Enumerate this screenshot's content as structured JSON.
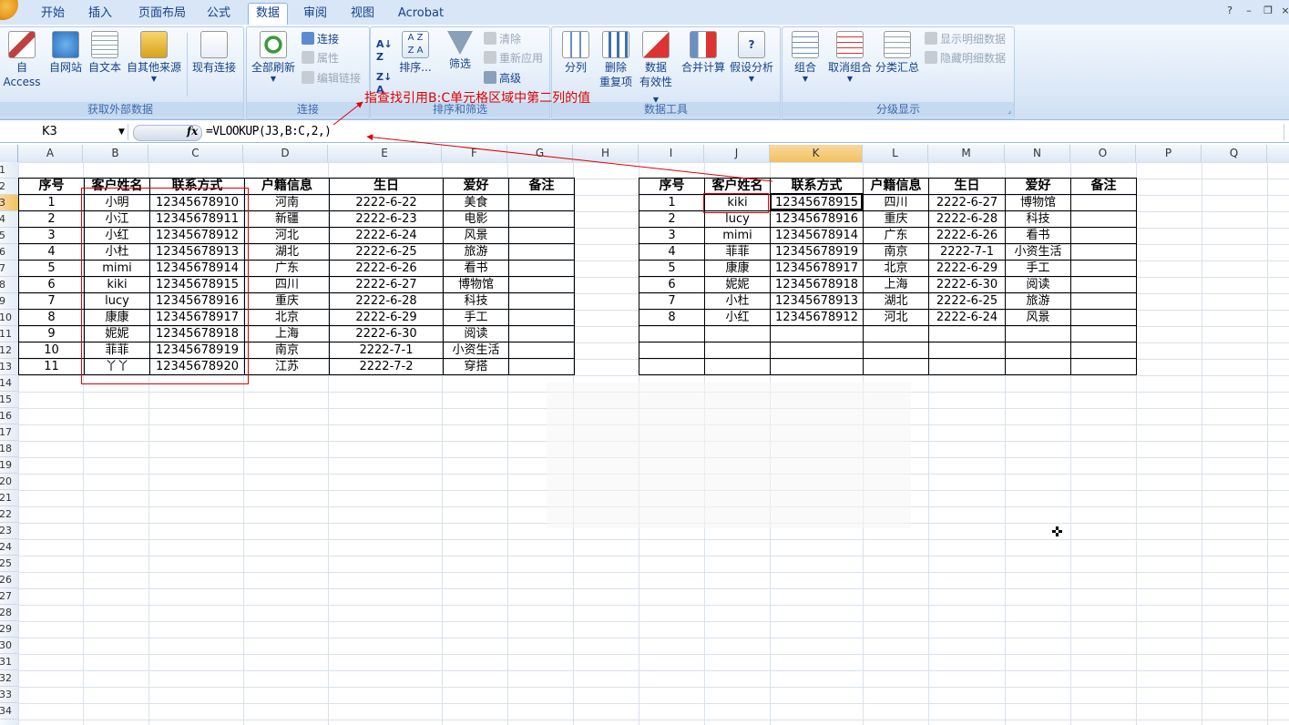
{
  "tabs": [
    {
      "label": "开始",
      "active": false
    },
    {
      "label": "插入",
      "active": false
    },
    {
      "label": "页面布局",
      "active": false
    },
    {
      "label": "公式",
      "active": false
    },
    {
      "label": "数据",
      "active": true
    },
    {
      "label": "审阅",
      "active": false
    },
    {
      "label": "视图",
      "active": false
    },
    {
      "label": "Acrobat",
      "active": false
    }
  ],
  "ribbon": {
    "external": {
      "label": "获取外部数据",
      "access": "自 Access",
      "web": "自网站",
      "text": "自文本",
      "other": "自其他来源",
      "existing": "现有连接"
    },
    "connections": {
      "label": "连接",
      "refresh_all": "全部刷新",
      "connections": "连接",
      "properties": "属性",
      "edit_links": "编辑链接"
    },
    "sort_filter": {
      "label": "排序和筛选",
      "sort": "排序...",
      "filter": "筛选",
      "clear": "清除",
      "reapply": "重新应用",
      "advanced": "高级"
    },
    "data_tools": {
      "label": "数据工具",
      "text_to_columns": "分列",
      "remove_dup_1": "删除",
      "remove_dup_2": "重复项",
      "validation_1": "数据",
      "validation_2": "有效性",
      "consolidate": "合并计算",
      "whatif": "假设分析"
    },
    "outline": {
      "label": "分级显示",
      "group": "组合",
      "ungroup": "取消组合",
      "subtotal": "分类汇总",
      "show_detail": "显示明细数据",
      "hide_detail": "隐藏明细数据"
    }
  },
  "formula_bar": {
    "name_box": "K3",
    "fx": "fx",
    "formula": "=VLOOKUP(J3,B:C,2,)"
  },
  "annotation": "指查找引用B:C单元格区域中第二列的值",
  "columns": [
    "A",
    "B",
    "C",
    "D",
    "E",
    "F",
    "G",
    "H",
    "I",
    "J",
    "K",
    "L",
    "M",
    "N",
    "O",
    "P",
    "Q"
  ],
  "selected_column": "K",
  "rows": [
    "1",
    "2",
    "3",
    "4",
    "5",
    "6",
    "7",
    "8",
    "9",
    "10",
    "11",
    "12",
    "13",
    "14",
    "15",
    "16",
    "17",
    "18",
    "19",
    "20",
    "21",
    "22",
    "23",
    "24",
    "25",
    "26",
    "27",
    "28",
    "29",
    "30",
    "31",
    "32",
    "33",
    "34"
  ],
  "selected_row": "3",
  "table_left": {
    "headers": [
      "序号",
      "客户姓名",
      "联系方式",
      "户籍信息",
      "生日",
      "爱好",
      "备注"
    ],
    "rows": [
      [
        "1",
        "小明",
        "12345678910",
        "河南",
        "2222-6-22",
        "美食",
        ""
      ],
      [
        "2",
        "小江",
        "12345678911",
        "新疆",
        "2222-6-23",
        "电影",
        ""
      ],
      [
        "3",
        "小红",
        "12345678912",
        "河北",
        "2222-6-24",
        "风景",
        ""
      ],
      [
        "4",
        "小杜",
        "12345678913",
        "湖北",
        "2222-6-25",
        "旅游",
        ""
      ],
      [
        "5",
        "mimi",
        "12345678914",
        "广东",
        "2222-6-26",
        "看书",
        ""
      ],
      [
        "6",
        "kiki",
        "12345678915",
        "四川",
        "2222-6-27",
        "博物馆",
        ""
      ],
      [
        "7",
        "lucy",
        "12345678916",
        "重庆",
        "2222-6-28",
        "科技",
        ""
      ],
      [
        "8",
        "康康",
        "12345678917",
        "北京",
        "2222-6-29",
        "手工",
        ""
      ],
      [
        "9",
        "妮妮",
        "12345678918",
        "上海",
        "2222-6-30",
        "阅读",
        ""
      ],
      [
        "10",
        "菲菲",
        "12345678919",
        "南京",
        "2222-7-1",
        "小资生活",
        ""
      ],
      [
        "11",
        "丫丫",
        "12345678920",
        "江苏",
        "2222-7-2",
        "穿搭",
        ""
      ]
    ]
  },
  "table_right": {
    "headers": [
      "序号",
      "客户姓名",
      "联系方式",
      "户籍信息",
      "生日",
      "爱好",
      "备注"
    ],
    "rows": [
      [
        "1",
        "kiki",
        "12345678915",
        "四川",
        "2222-6-27",
        "博物馆",
        ""
      ],
      [
        "2",
        "lucy",
        "12345678916",
        "重庆",
        "2222-6-28",
        "科技",
        ""
      ],
      [
        "3",
        "mimi",
        "12345678914",
        "广东",
        "2222-6-26",
        "看书",
        ""
      ],
      [
        "4",
        "菲菲",
        "12345678919",
        "南京",
        "2222-7-1",
        "小资生活",
        ""
      ],
      [
        "5",
        "康康",
        "12345678917",
        "北京",
        "2222-6-29",
        "手工",
        ""
      ],
      [
        "6",
        "妮妮",
        "12345678918",
        "上海",
        "2222-6-30",
        "阅读",
        ""
      ],
      [
        "7",
        "小杜",
        "12345678913",
        "湖北",
        "2222-6-25",
        "旅游",
        ""
      ],
      [
        "8",
        "小红",
        "12345678912",
        "河北",
        "2222-6-24",
        "风景",
        ""
      ],
      [
        "",
        "",
        "",
        "",
        "",
        "",
        ""
      ],
      [
        "",
        "",
        "",
        "",
        "",
        "",
        ""
      ],
      [
        "",
        "",
        "",
        "",
        "",
        "",
        ""
      ]
    ]
  },
  "colors": {
    "annotation": "#e00000",
    "ribbon_text": "#15428b",
    "selected_header": "#f1c15f"
  }
}
